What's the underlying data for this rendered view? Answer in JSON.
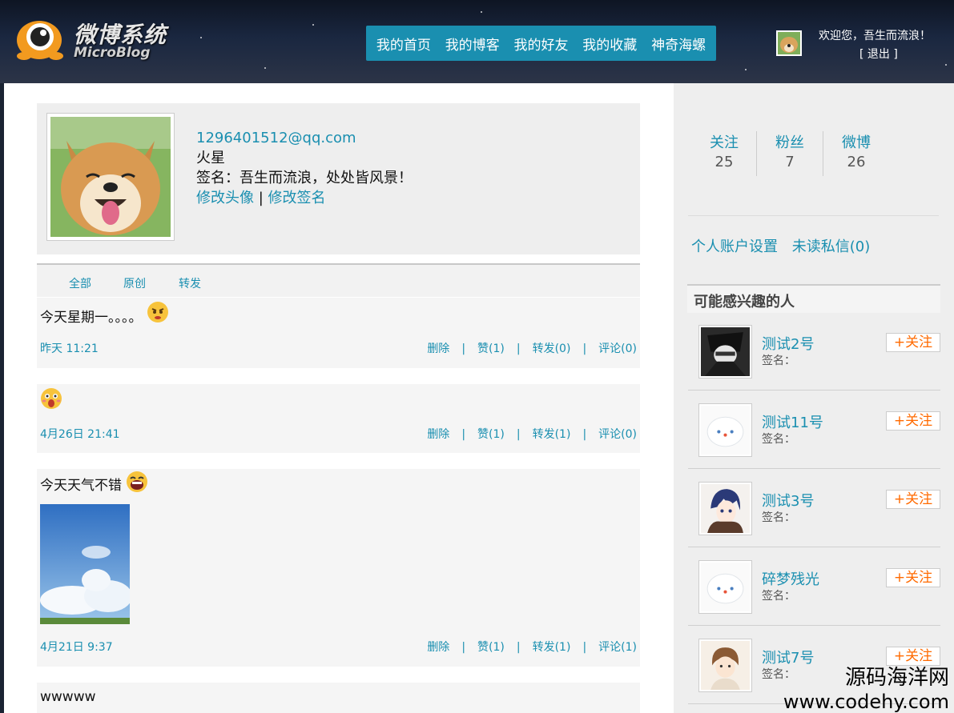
{
  "header": {
    "logo_title": "微博系统",
    "logo_sub": "MicroBlog",
    "nav": [
      "我的首页",
      "我的博客",
      "我的好友",
      "我的收藏",
      "神奇海螺"
    ],
    "welcome": "欢迎您，吾生而流浪！",
    "logout": "[ 退出 ]"
  },
  "profile": {
    "email": "1296401512@qq.com",
    "name": "火星",
    "signature": "签名：吾生而流浪，处处皆风景！",
    "edit_avatar": "修改头像",
    "separator": "|",
    "edit_signature": "修改签名"
  },
  "tabs": [
    "全部",
    "原创",
    "转发"
  ],
  "posts": [
    {
      "text": "今天星期一。。。。",
      "time": "昨天 11:21",
      "delete": "删除",
      "like": "赞(1)",
      "repost": "转发(0)",
      "comment": "评论(0)"
    },
    {
      "text": "",
      "time": "4月26日 21:41",
      "delete": "删除",
      "like": "赞(1)",
      "repost": "转发(1)",
      "comment": "评论(0)"
    },
    {
      "text": "今天天气不错",
      "time": "4月21日 9:37",
      "delete": "删除",
      "like": "赞(1)",
      "repost": "转发(1)",
      "comment": "评论(1)"
    },
    {
      "text": "wwwww"
    }
  ],
  "sidebar": {
    "stats": [
      {
        "label": "关注",
        "value": "25"
      },
      {
        "label": "粉丝",
        "value": "7"
      },
      {
        "label": "微博",
        "value": "26"
      }
    ],
    "account_settings": "个人账户设置",
    "unread_messages": "未读私信(0)",
    "interest_title": "可能感兴趣的人",
    "people": [
      {
        "name": "测试2号",
        "signature": "签名：",
        "follow": "+关注"
      },
      {
        "name": "测试11号",
        "signature": "签名：",
        "follow": "+关注"
      },
      {
        "name": "测试3号",
        "signature": "签名：",
        "follow": "+关注"
      },
      {
        "name": "碎梦残光",
        "signature": "签名：",
        "follow": "+关注"
      },
      {
        "name": "测试7号",
        "signature": "签名：",
        "follow": "+关注"
      }
    ]
  },
  "watermark": {
    "line1": "源码海洋网",
    "line2": "www.codehy.com"
  },
  "colors": {
    "accent": "#1a8fb0",
    "follow": "#ff6a00",
    "nav_bg": "#1a8fb0"
  }
}
